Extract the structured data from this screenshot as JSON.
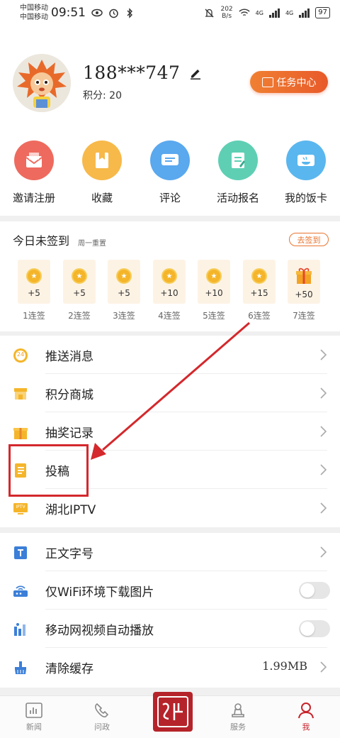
{
  "status_bar": {
    "carrier1": "中国移动",
    "carrier2": "中国移动",
    "time": "09:51",
    "speed_value": "202",
    "speed_unit": "B/s",
    "net1": "4G",
    "net2": "4G",
    "battery": "97"
  },
  "profile": {
    "username": "188***747",
    "points": "积分: 20",
    "task_button": "任务中心"
  },
  "actions": [
    {
      "label": "邀请注册",
      "icon": "invite-icon",
      "color": "#ee6a5e"
    },
    {
      "label": "收藏",
      "icon": "favorite-icon",
      "color": "#f7b94a"
    },
    {
      "label": "评论",
      "icon": "comment-icon",
      "color": "#5aa8ee"
    },
    {
      "label": "活动报名",
      "icon": "signup-icon",
      "color": "#5fcfb4"
    },
    {
      "label": "我的饭卡",
      "icon": "meal-card-icon",
      "color": "#5ab6ee"
    }
  ],
  "checkin": {
    "title": "今日未签到",
    "subtitle": "周一重置",
    "button": "去签到",
    "days": [
      {
        "value": "+5",
        "label": "1连签"
      },
      {
        "value": "+5",
        "label": "2连签"
      },
      {
        "value": "+5",
        "label": "3连签"
      },
      {
        "value": "+10",
        "label": "4连签"
      },
      {
        "value": "+10",
        "label": "5连签"
      },
      {
        "value": "+15",
        "label": "6连签"
      },
      {
        "value": "+50",
        "label": "7连签"
      }
    ]
  },
  "menu": [
    {
      "label": "推送消息",
      "icon": "push-message-icon"
    },
    {
      "label": "积分商城",
      "icon": "points-mall-icon"
    },
    {
      "label": "抽奖记录",
      "icon": "lottery-icon"
    },
    {
      "label": "投稿",
      "icon": "submit-article-icon"
    },
    {
      "label": "湖北IPTV",
      "icon": "iptv-icon"
    }
  ],
  "push_badge": "24",
  "iptv_badge": "IPTV",
  "settings": [
    {
      "label": "正文字号",
      "icon": "font-size-icon"
    },
    {
      "label": "仅WiFi环境下载图片",
      "icon": "wifi-icon"
    },
    {
      "label": "移动网视频自动播放",
      "icon": "video-autoplay-icon"
    },
    {
      "label": "清除缓存",
      "icon": "clear-cache-icon",
      "value": "1.99MB"
    }
  ],
  "nav": [
    {
      "label": "新闻",
      "icon": "news-icon"
    },
    {
      "label": "问政",
      "icon": "inquiry-icon"
    },
    {
      "label": "服务",
      "icon": "service-icon"
    },
    {
      "label": "我",
      "icon": "me-icon"
    }
  ],
  "colors": {
    "accent": "#e8742f",
    "highlight": "#d4282c",
    "nav_active": "#c8232b"
  }
}
